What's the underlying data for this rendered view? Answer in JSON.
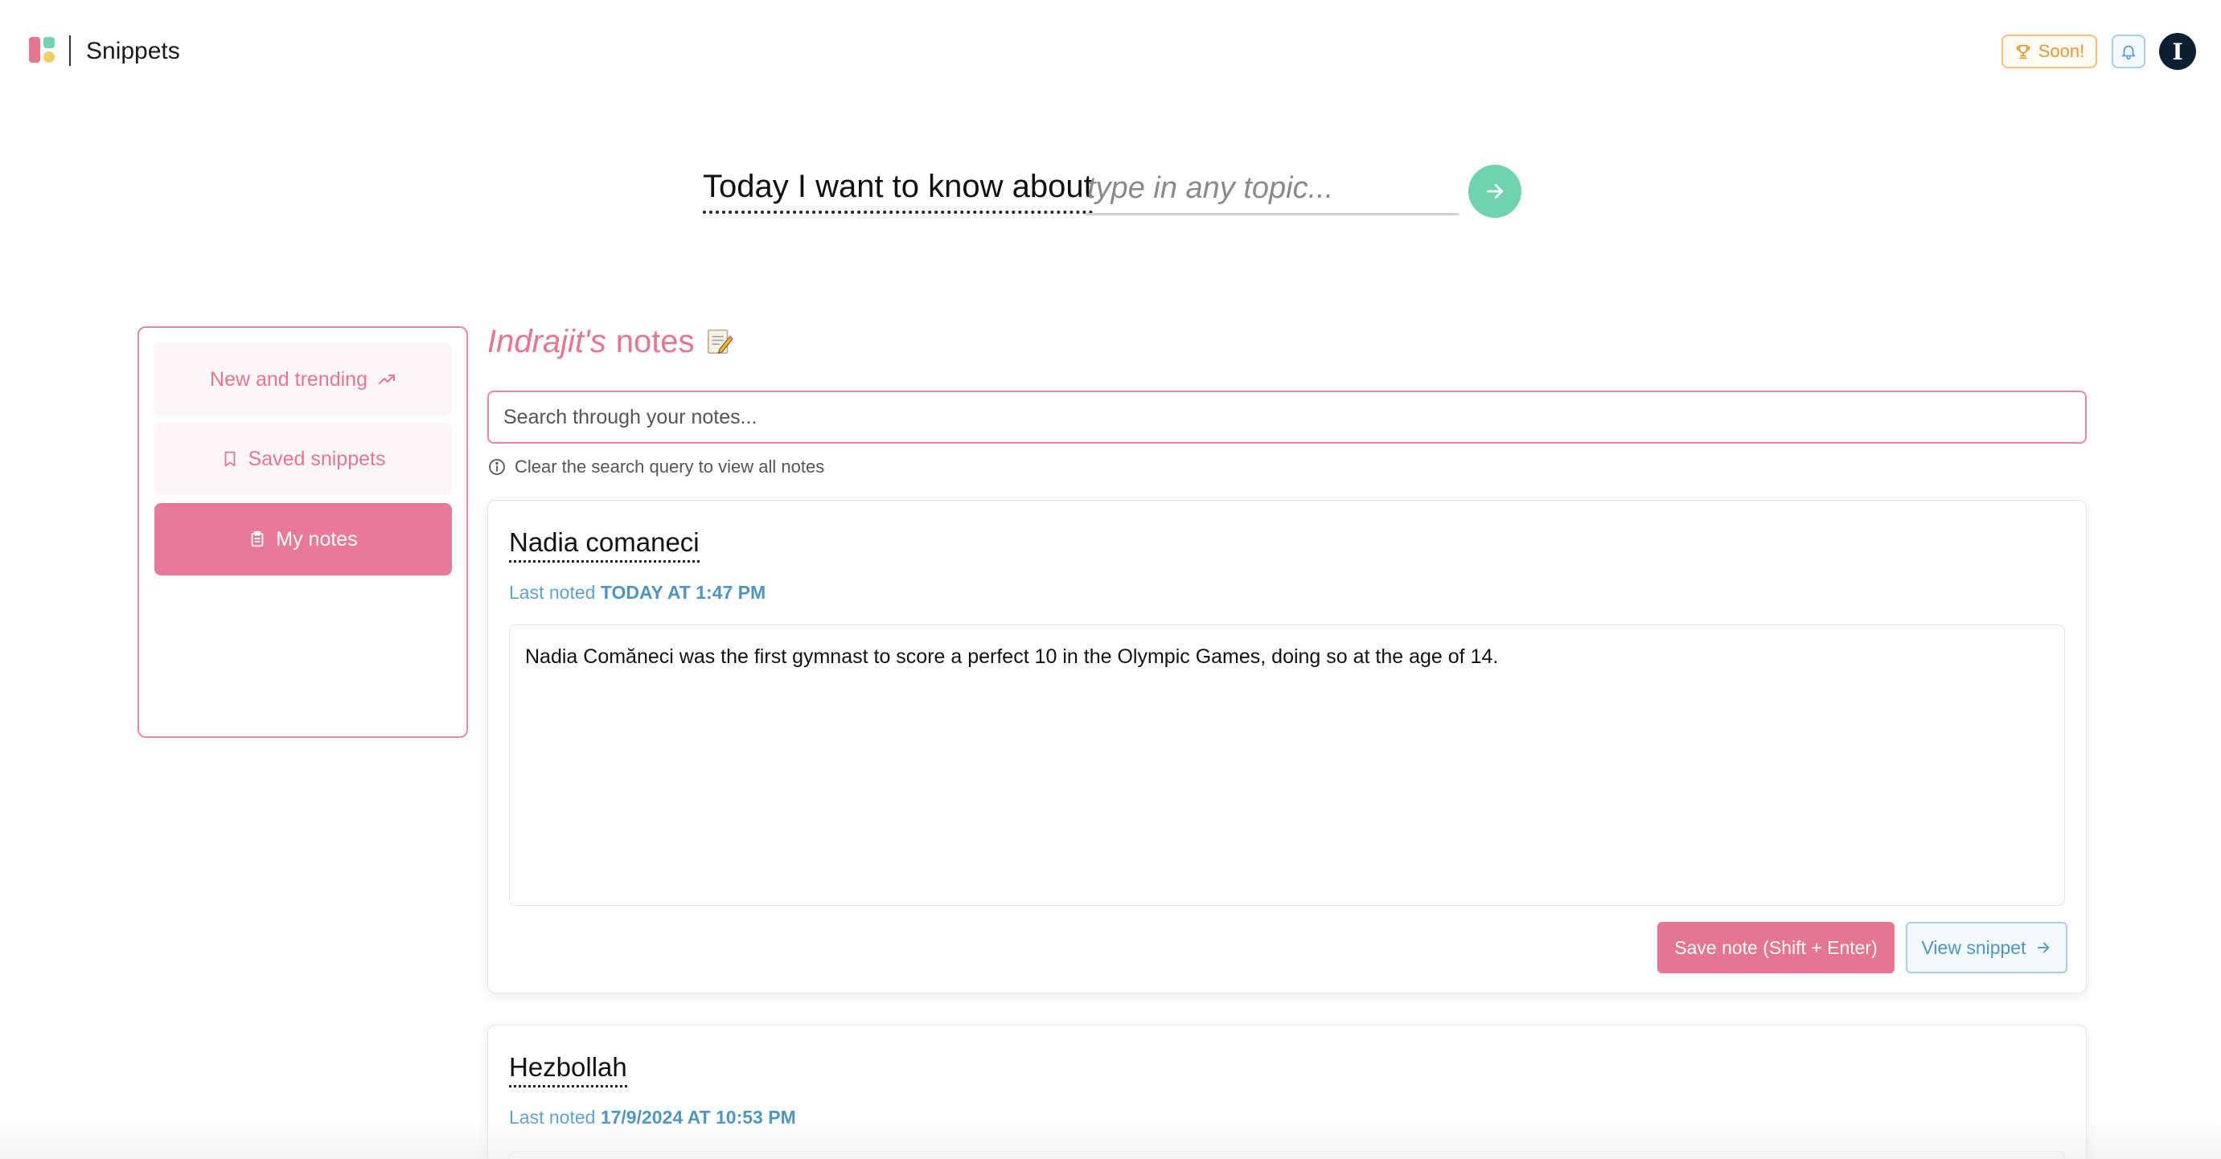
{
  "header": {
    "app_title": "Snippets",
    "soon_label": "Soon!",
    "avatar_initial": "I"
  },
  "topic": {
    "prompt": "Today I want to know about",
    "placeholder": "type in any topic..."
  },
  "sidebar": {
    "items": [
      {
        "label": "New and trending",
        "icon": "trending-up-icon",
        "active": false
      },
      {
        "label": "Saved snippets",
        "icon": "bookmark-icon",
        "active": false
      },
      {
        "label": "My notes",
        "icon": "notes-icon",
        "active": true
      }
    ]
  },
  "main": {
    "owner": "Indrajit's",
    "heading_suffix": "notes",
    "search_placeholder": "Search through your notes...",
    "search_hint": "Clear the search query to view all notes",
    "notes": [
      {
        "title": "Nadia comaneci",
        "meta_prefix": "Last noted",
        "meta_time": "TODAY AT 1:47 PM",
        "text": "Nadia Comăneci was the first gymnast to score a perfect 10 in the Olympic Games, doing so at the age of 14.",
        "save_label": "Save note (Shift + Enter)",
        "view_label": "View snippet"
      },
      {
        "title": "Hezbollah",
        "meta_prefix": "Last noted",
        "meta_time": "17/9/2024 AT 10:53 PM"
      }
    ]
  },
  "colors": {
    "accent_pink": "#e6758f",
    "accent_green": "#6fd3b0",
    "accent_blue": "#4f95bf",
    "accent_orange": "#e59a3a"
  }
}
